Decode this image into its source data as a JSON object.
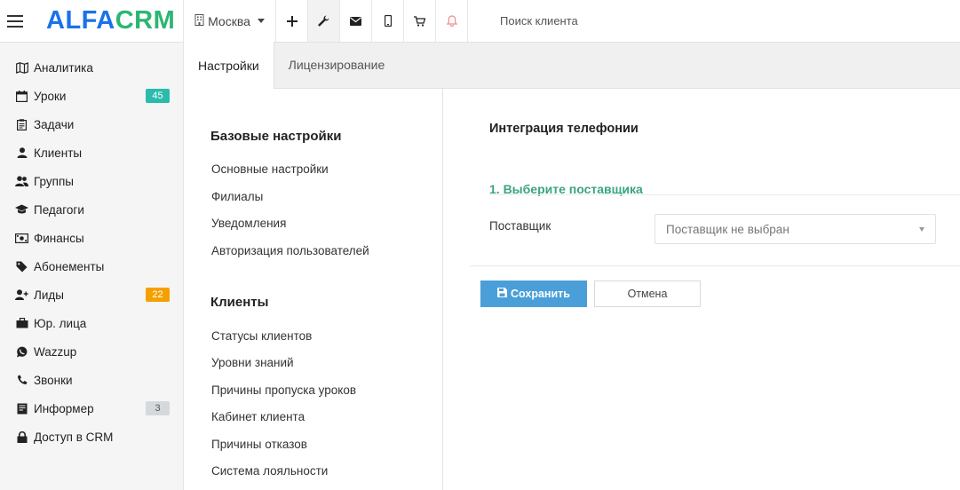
{
  "header": {
    "logo_alfa": "ALFA",
    "logo_crm": "CRM",
    "city": "Москва",
    "search_placeholder": "Поиск клиента",
    "icons": [
      "menu-icon",
      "building-icon",
      "plus-icon",
      "wrench-icon",
      "mail-icon",
      "mobile-icon",
      "cart-icon",
      "bell-icon"
    ]
  },
  "sidebar": {
    "items": [
      {
        "label": "Аналитика",
        "icon": "map-icon"
      },
      {
        "label": "Уроки",
        "icon": "calendar-icon",
        "badge": "45",
        "badge_color": "#2bbbad"
      },
      {
        "label": "Задачи",
        "icon": "clipboard-icon"
      },
      {
        "label": "Клиенты",
        "icon": "user-icon"
      },
      {
        "label": "Группы",
        "icon": "users-icon"
      },
      {
        "label": "Педагоги",
        "icon": "graduation-cap-icon"
      },
      {
        "label": "Финансы",
        "icon": "money-icon"
      },
      {
        "label": "Абонементы",
        "icon": "tag-icon"
      },
      {
        "label": "Лиды",
        "icon": "user-plus-icon",
        "badge": "22",
        "badge_color": "#f4a100"
      },
      {
        "label": "Юр. лица",
        "icon": "briefcase-icon"
      },
      {
        "label": "Wazzup",
        "icon": "whatsapp-icon"
      },
      {
        "label": "Звонки",
        "icon": "phone-icon"
      },
      {
        "label": "Информер",
        "icon": "book-icon",
        "badge": "3",
        "badge_color": "#d5d9dc"
      },
      {
        "label": "Доступ в CRM",
        "icon": "lock-icon"
      }
    ]
  },
  "tabs": [
    {
      "label": "Настройки",
      "active": true
    },
    {
      "label": "Лицензирование",
      "active": false
    }
  ],
  "settings_menu": {
    "groups": [
      {
        "heading": "Базовые настройки",
        "links": [
          "Основные настройки",
          "Филиалы",
          "Уведомления",
          "Авторизация пользователей"
        ]
      },
      {
        "heading": "Клиенты",
        "links": [
          "Статусы клиентов",
          "Уровни знаний",
          "Причины пропуска уроков",
          "Кабинет клиента",
          "Причины отказов",
          "Система лояльности"
        ]
      }
    ]
  },
  "main": {
    "title": "Интеграция телефонии",
    "step": "1. Выберите поставщика",
    "provider_label": "Поставщик",
    "provider_value": "Поставщик не выбран",
    "save_label": "Сохранить",
    "cancel_label": "Отмена"
  },
  "colors": {
    "accent_blue": "#4a9fd8",
    "step_green": "#3aa57d",
    "logo_blue": "#1a73e8",
    "logo_green": "#2bb673"
  }
}
